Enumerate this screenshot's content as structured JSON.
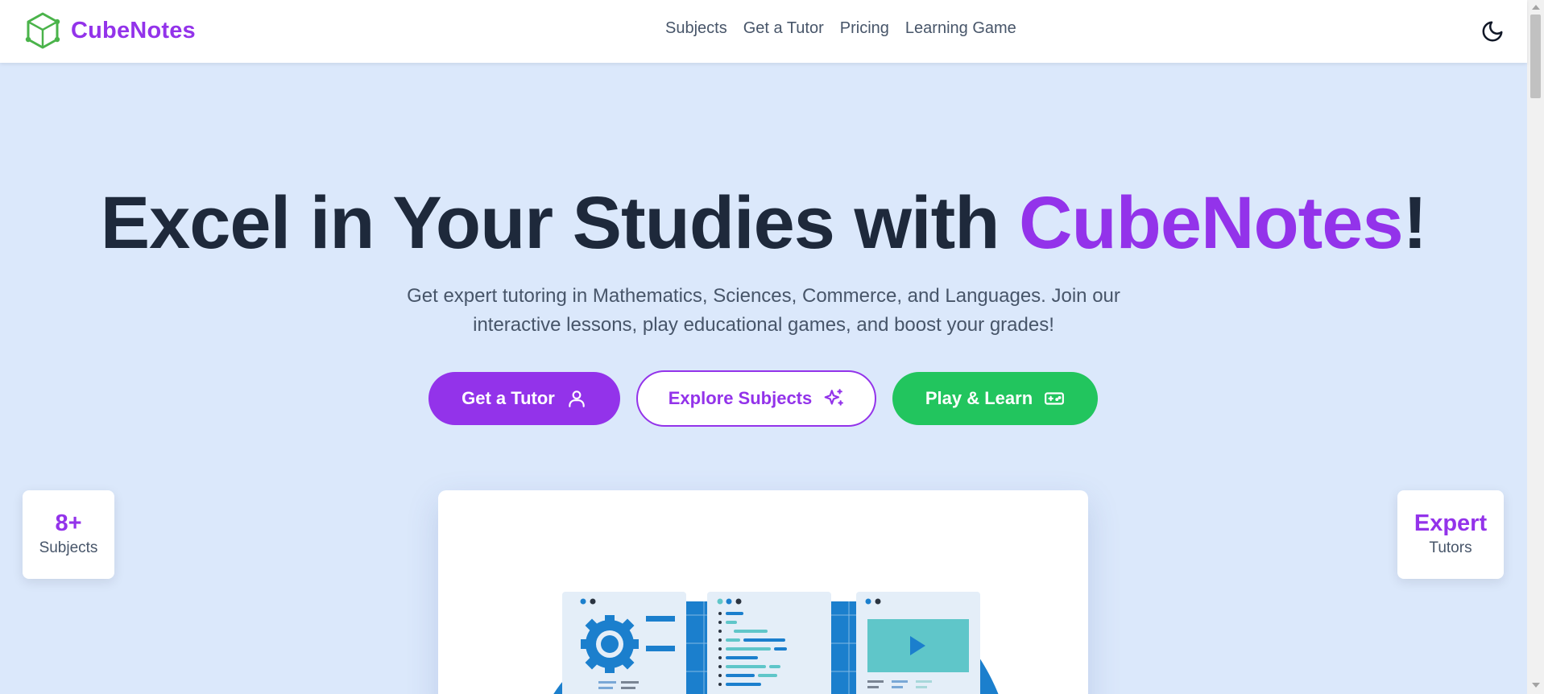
{
  "header": {
    "brand_name": "CubeNotes",
    "logo_icon": "cube-icon",
    "nav": [
      {
        "label": "Subjects"
      },
      {
        "label": "Get a Tutor"
      },
      {
        "label": "Pricing"
      },
      {
        "label": "Learning Game"
      }
    ],
    "theme_toggle_icon": "moon-icon"
  },
  "hero": {
    "title_main": "Excel in Your Studies with ",
    "title_accent": "CubeNotes",
    "title_end": "!",
    "subtitle": "Get expert tutoring in Mathematics, Sciences, Commerce, and Languages. Join our interactive lessons, play educational games, and boost your grades!",
    "buttons": {
      "tutor": {
        "label": "Get a Tutor",
        "icon": "user-icon"
      },
      "explore": {
        "label": "Explore Subjects",
        "icon": "sparkles-icon"
      },
      "play": {
        "label": "Play & Learn",
        "icon": "gamepad-icon"
      }
    }
  },
  "stats": {
    "left": {
      "value": "8+",
      "label": "Subjects"
    },
    "right": {
      "value": "Expert",
      "label": "Tutors"
    }
  },
  "colors": {
    "brand_purple": "#9333ea",
    "play_green": "#22c55e",
    "page_bg": "#dbe8fb",
    "illustration_blue": "#1b7fcd",
    "illustration_teal": "#5fc6c9"
  }
}
